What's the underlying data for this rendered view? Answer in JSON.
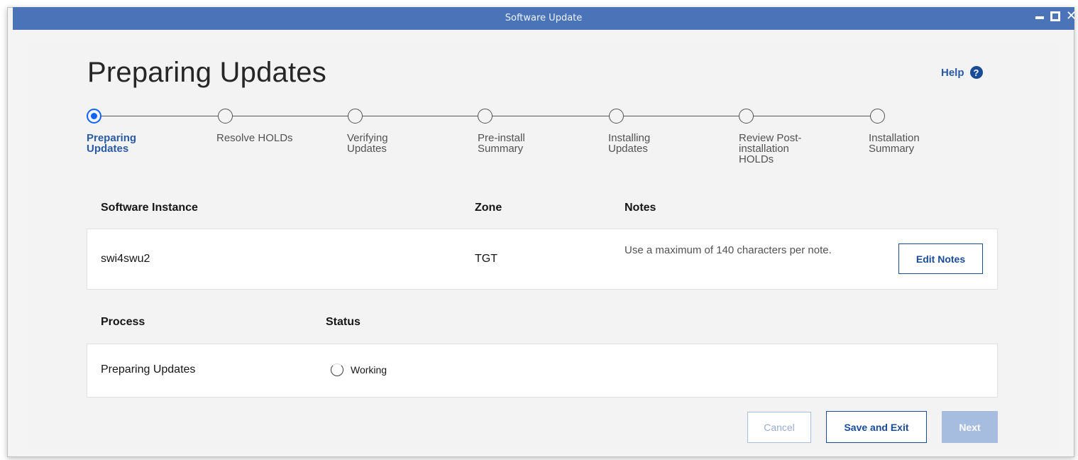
{
  "window": {
    "title": "Software Update",
    "controls": {
      "minimize": "minimize-icon",
      "maximize": "maximize-icon",
      "close": "close-icon"
    }
  },
  "header": {
    "title": "Preparing Updates",
    "help_label": "Help",
    "help_icon": "question-circle-icon"
  },
  "steps": [
    {
      "label": "Preparing Updates",
      "active": true
    },
    {
      "label": "Resolve HOLDs",
      "active": false
    },
    {
      "label": "Verifying Updates",
      "active": false
    },
    {
      "label": "Pre-install Summary",
      "active": false
    },
    {
      "label": "Installing Updates",
      "active": false
    },
    {
      "label": "Review Post-installation HOLDs",
      "active": false
    },
    {
      "label": "Installation Summary",
      "active": false
    }
  ],
  "instance_table": {
    "headers": {
      "instance": "Software Instance",
      "zone": "Zone",
      "notes": "Notes"
    },
    "row": {
      "instance": "swi4swu2",
      "zone": "TGT",
      "notes": "Use a maximum of 140 characters per note.",
      "edit_button": "Edit Notes"
    }
  },
  "process_table": {
    "headers": {
      "process": "Process",
      "status": "Status"
    },
    "row": {
      "process": "Preparing Updates",
      "status": "Working",
      "status_icon": "spinner-icon"
    }
  },
  "footer": {
    "cancel_label": "Cancel",
    "save_exit_label": "Save and Exit",
    "next_label": "Next"
  },
  "colors": {
    "titlebar": "#4a74b7",
    "accent": "#0f62fe",
    "link": "#1a4b99",
    "disabled_button": "#a6bddf"
  }
}
